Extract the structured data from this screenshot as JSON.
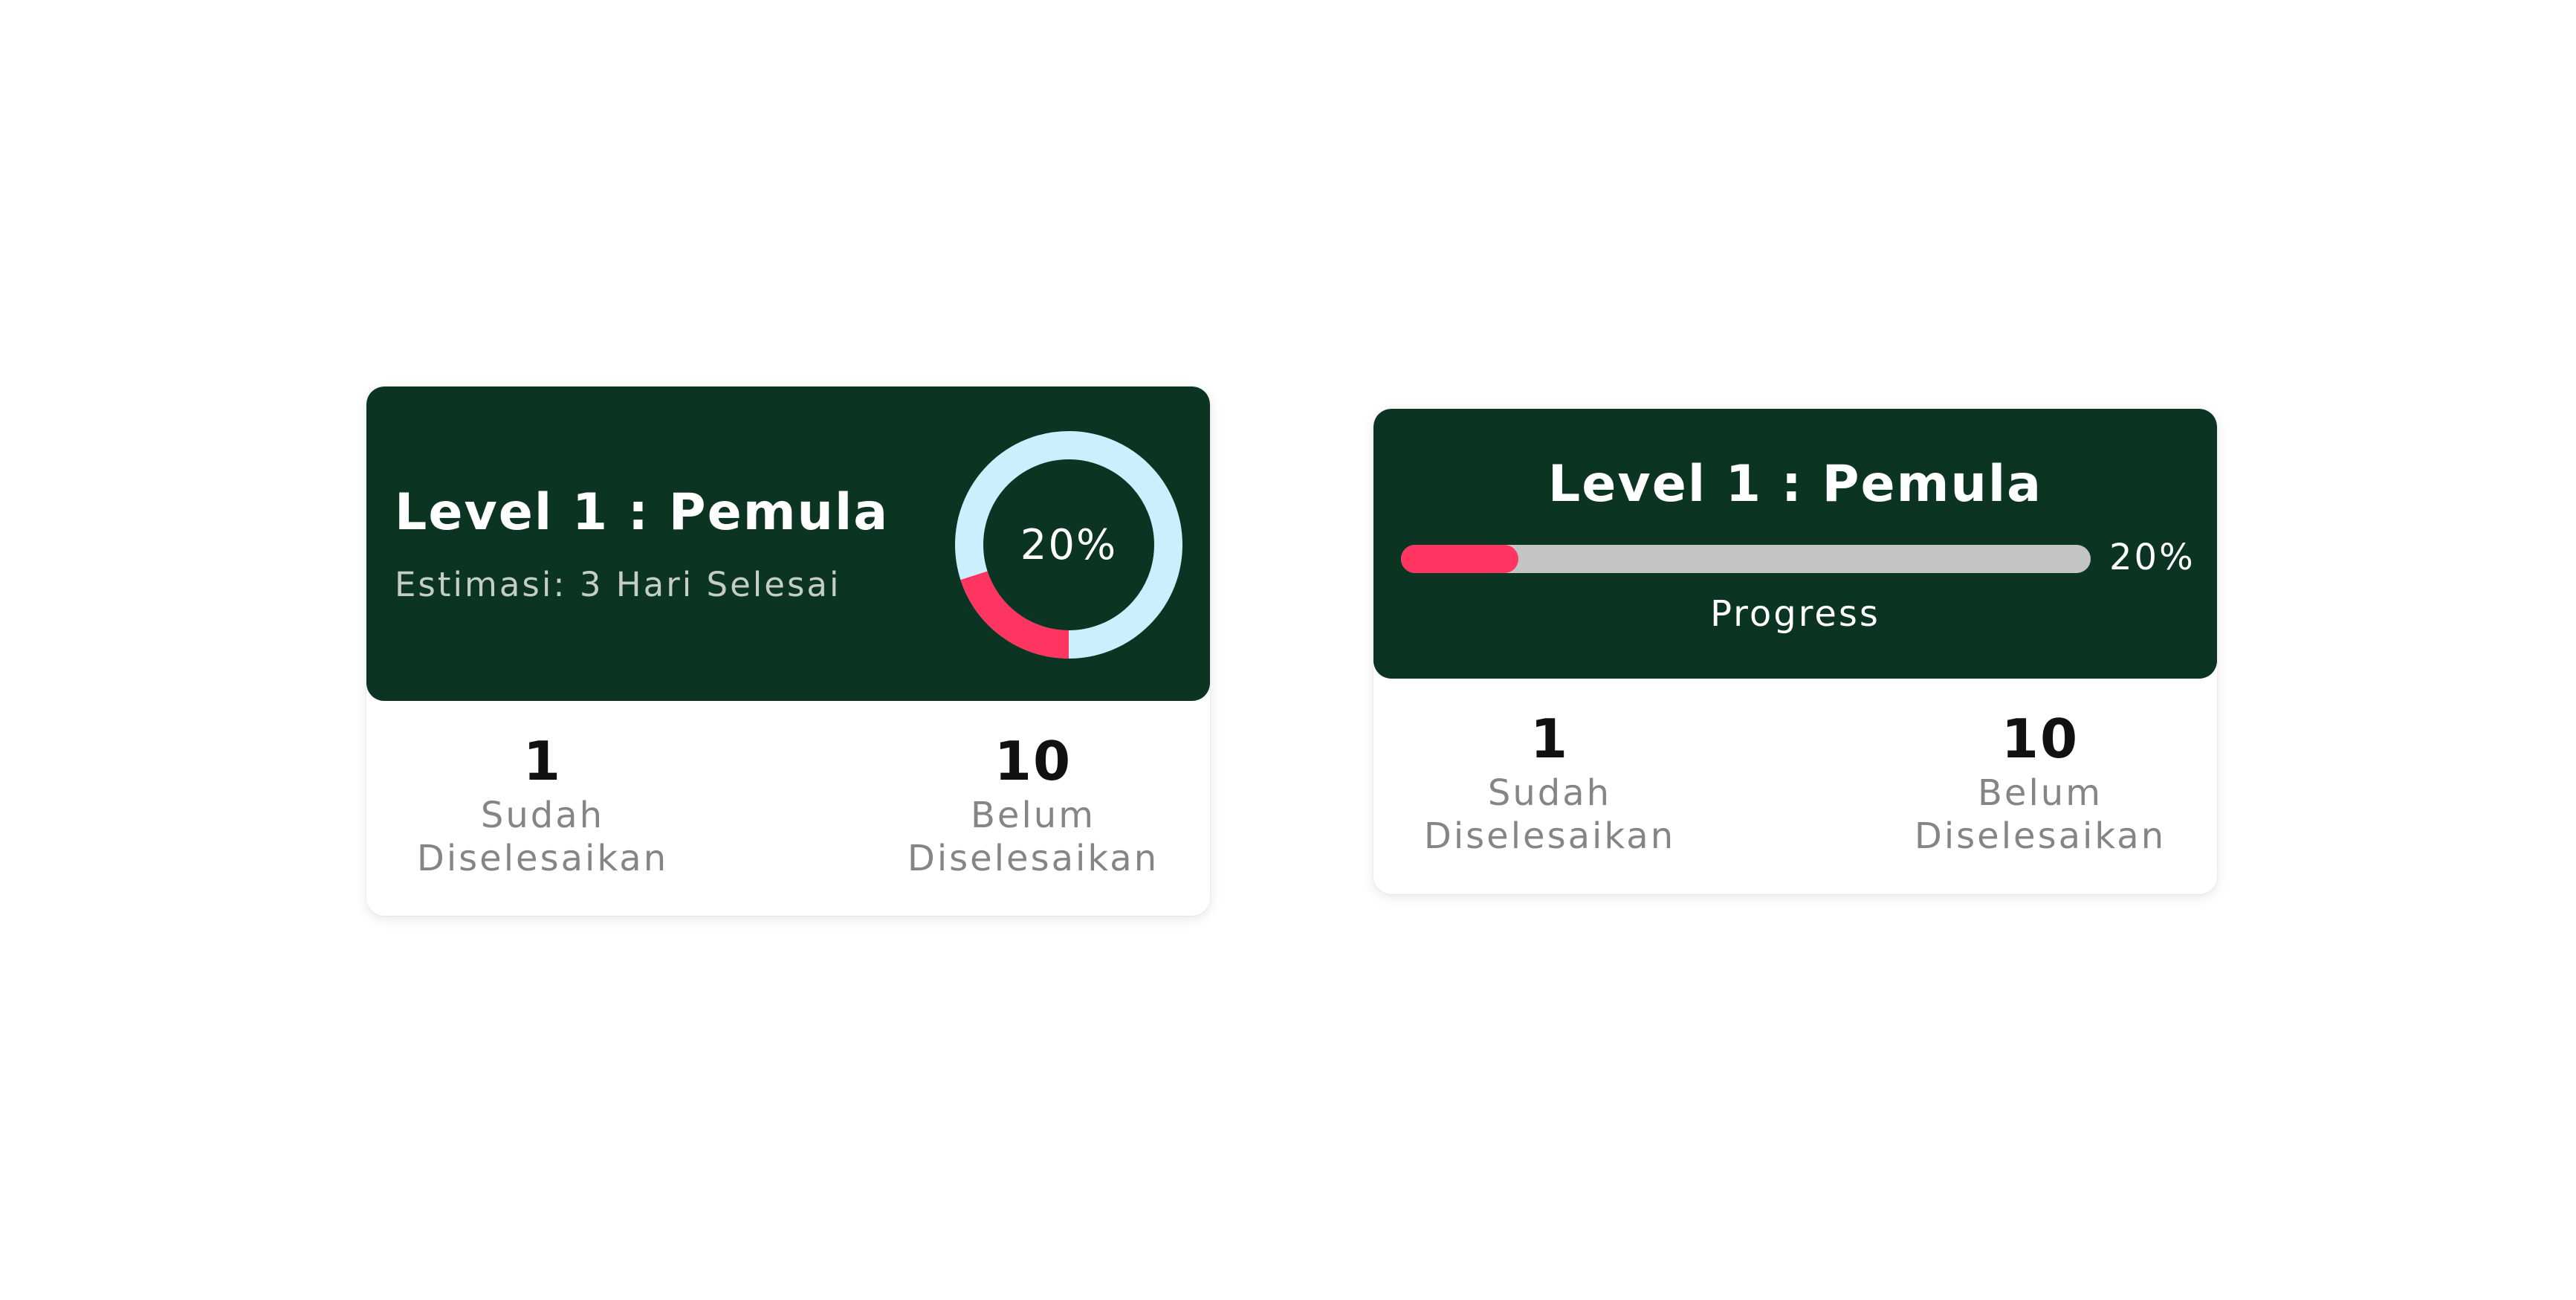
{
  "colors": {
    "header_bg": "#0b3522",
    "accent_red": "#ff3561",
    "ring_light": "#cdeefc",
    "track_grey": "#c4c4c4"
  },
  "card_circle": {
    "title": "Level 1 : Pemula",
    "estimate": "Estimasi: 3 Hari Selesai",
    "progress_label": "20%",
    "progress_value": 0.2,
    "done_count": "1",
    "done_label": "Sudah\nDiselesaikan",
    "todo_count": "10",
    "todo_label": "Belum\nDiselesaikan"
  },
  "card_bar": {
    "title": "Level 1 : Pemula",
    "progress_label": "20%",
    "progress_value": 0.2,
    "caption": "Progress",
    "done_count": "1",
    "done_label": "Sudah\nDiselesaikan",
    "todo_count": "10",
    "todo_label": "Belum\nDiselesaikan"
  }
}
